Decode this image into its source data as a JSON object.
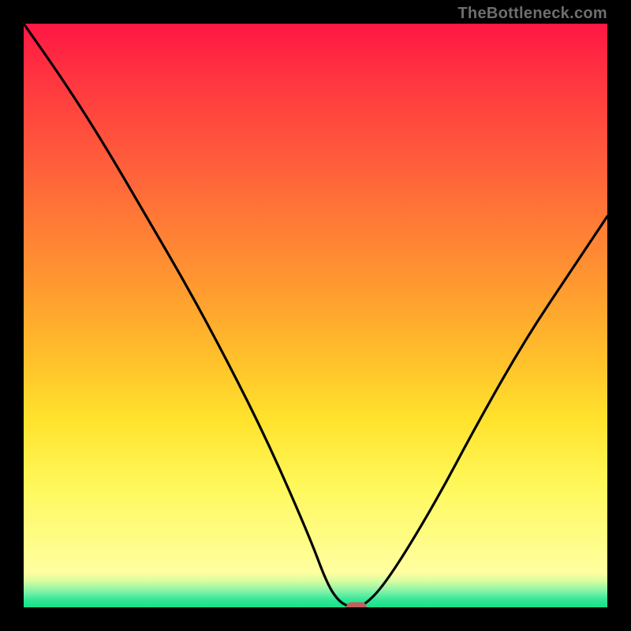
{
  "watermark": "TheBottleneck.com",
  "colors": {
    "frame_bg": "#000000",
    "curve_stroke": "#000000",
    "marker_fill": "#c25e5e",
    "gradient_top": "#ff1744",
    "gradient_mid1": "#ff9a30",
    "gradient_mid2": "#fff85a",
    "gradient_bottom": "#16e08a"
  },
  "chart_data": {
    "type": "line",
    "title": "",
    "xlabel": "",
    "ylabel": "",
    "xlim": [
      0,
      100
    ],
    "ylim": [
      0,
      100
    ],
    "grid": false,
    "series": [
      {
        "name": "bottleneck_curve",
        "x": [
          0,
          7,
          14,
          21,
          28,
          35,
          42,
          49,
          52,
          54,
          56,
          58,
          62,
          70,
          78,
          86,
          94,
          100
        ],
        "y": [
          100,
          90,
          79,
          67,
          55,
          42,
          28,
          12,
          4,
          1,
          0,
          0,
          4,
          17,
          32,
          46,
          58,
          67
        ]
      }
    ],
    "marker": {
      "x": 57,
      "y": 0
    },
    "legend": false,
    "annotations": []
  }
}
